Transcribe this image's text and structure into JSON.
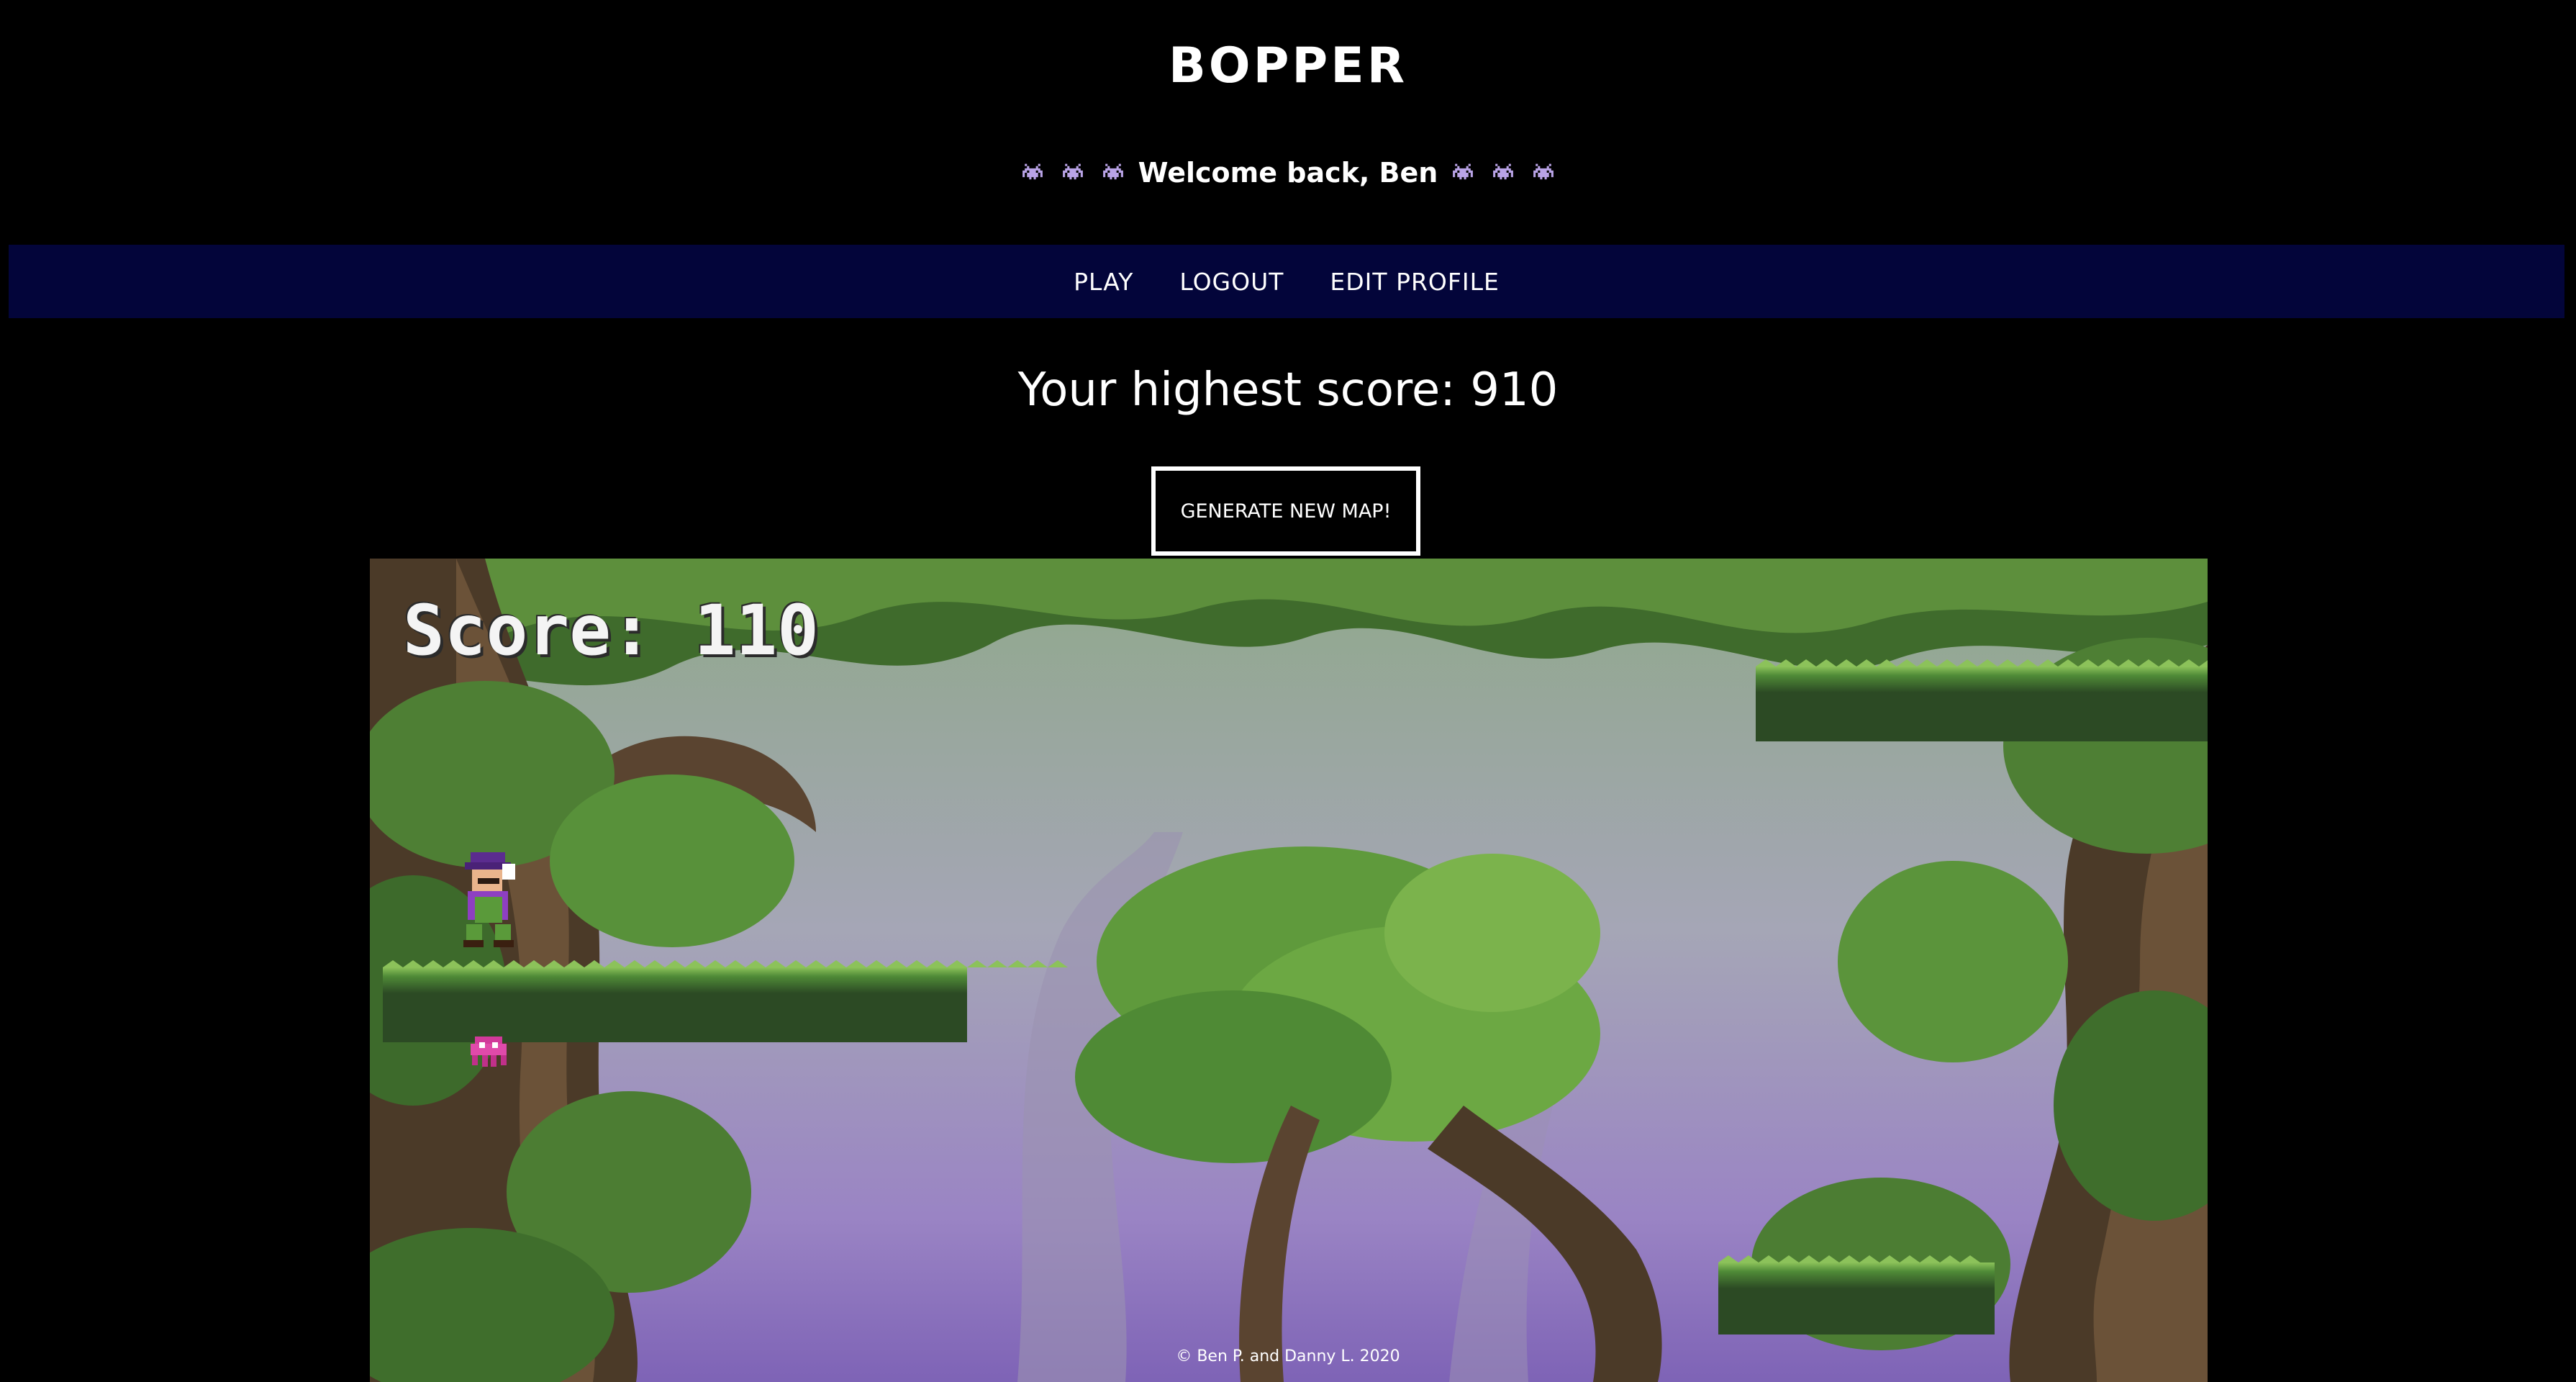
{
  "site": {
    "title": "BOPPER",
    "welcome": "Welcome back, Ben"
  },
  "nav": {
    "items": [
      {
        "label": "PLAY"
      },
      {
        "label": "LOGOUT"
      },
      {
        "label": "EDIT PROFILE"
      }
    ]
  },
  "score_panel": {
    "highest_label": "Your highest score: 910",
    "generate_button": "GENERATE NEW MAP!"
  },
  "game": {
    "score_text": "Score: 110"
  },
  "footer": {
    "credit": "© Ben P. and Danny L. 2020"
  },
  "colors": {
    "background": "#000000",
    "nav_bar": "#03053a",
    "text": "#ffffff",
    "alien": "#b9a3e6"
  },
  "icons": {
    "welcome_decoration": "space-invader-icon",
    "player": "mario-sprite",
    "enemy": "pink-octopus-sprite"
  }
}
